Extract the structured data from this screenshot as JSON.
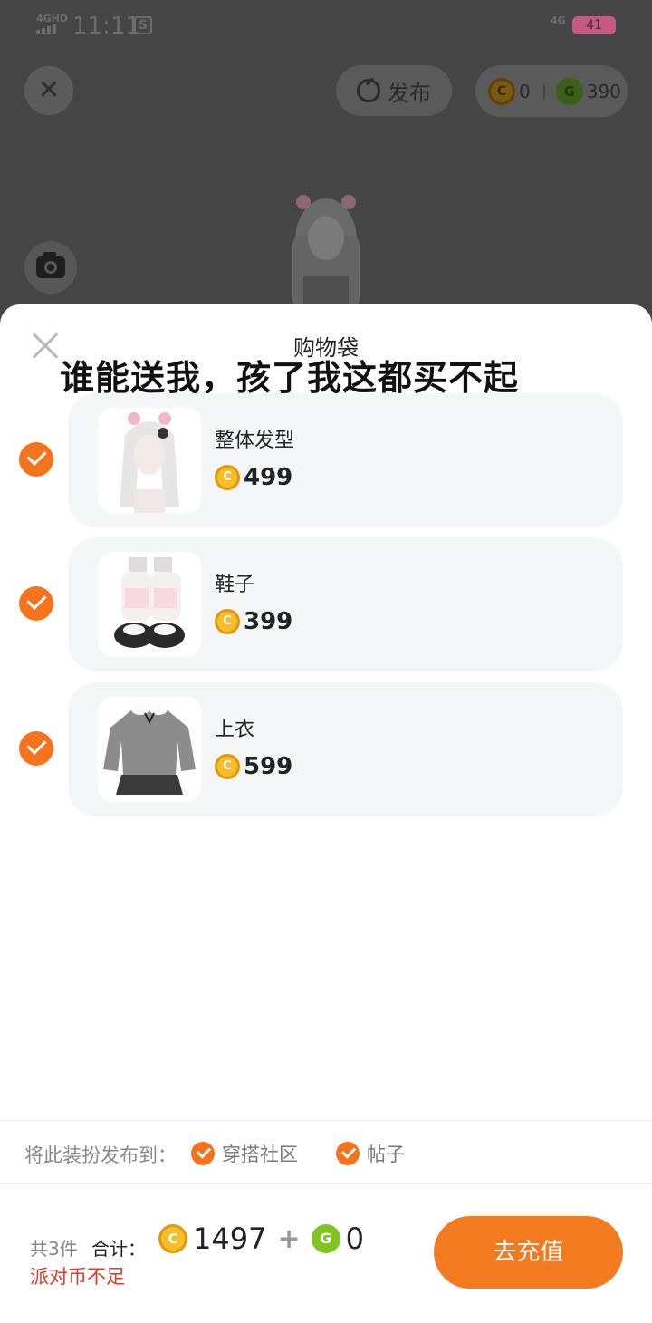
{
  "status_bar": {
    "network": "4GHD",
    "time": "11:11",
    "app_badge": "S",
    "network_right": "4G",
    "battery": "41"
  },
  "header": {
    "publish_label": "发布",
    "party_coins": "0",
    "g_coins": "390"
  },
  "sheet": {
    "title": "购物袋",
    "overlay_caption": "谁能送我，孩了我这都买不起",
    "items": [
      {
        "name": "整体发型",
        "price": "499",
        "checked": true,
        "thumb_icon": "hairstyle-icon"
      },
      {
        "name": "鞋子",
        "price": "399",
        "checked": true,
        "thumb_icon": "shoes-icon"
      },
      {
        "name": "上衣",
        "price": "599",
        "checked": true,
        "thumb_icon": "top-icon"
      }
    ],
    "publish_to": {
      "label": "将此装扮发布到：",
      "options": [
        "穿搭社区",
        "帖子"
      ]
    },
    "footer": {
      "count": "共3件",
      "total_label": "合计：",
      "total_coins": "1497",
      "plus": "+",
      "total_g": "0",
      "warning": "派对币不足",
      "recharge_label": "去充值"
    }
  },
  "colors": {
    "accent_orange": "#f4731c",
    "warning_red": "#e5362b",
    "card_bg": "#f4f6f8",
    "coin_gold": "#f5be2a",
    "g_coin_green": "#7fc41f"
  }
}
